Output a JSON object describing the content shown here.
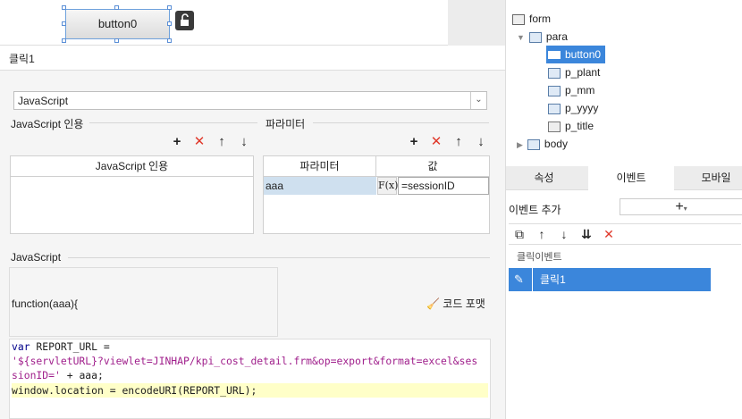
{
  "canvas": {
    "button_label": "button0"
  },
  "event_panel": {
    "title": "클릭1",
    "language_select": "JavaScript",
    "js_ref_label": "JavaScript 인용",
    "js_ref_header": "JavaScript 인용",
    "params_label": "파라미터",
    "params_header_name": "파라미터",
    "params_header_value": "값",
    "params_rows": [
      {
        "name": "aaa",
        "fx": "F(x)",
        "value": "=sessionID"
      }
    ],
    "js_label": "JavaScript",
    "function_sig": "function(aaa){",
    "format_button": "코드 포맷",
    "code": {
      "l1_kw": "var",
      "l1_rest": " REPORT_URL =",
      "l2": "'${servletURL}?viewlet=JINHAP/kpi_cost_detail.frm&op=export&format=excel&ses",
      "l3_str": "sionID='",
      "l3_rest": " + aaa;",
      "l4": "window.location = encodeURI(REPORT_URL);"
    }
  },
  "tree": {
    "root": "form",
    "para": "para",
    "children": [
      "button0",
      "p_plant",
      "p_mm",
      "p_yyyy",
      "p_title"
    ],
    "body": "body"
  },
  "tabs": {
    "properties": "속성",
    "events": "이벤트",
    "mobile": "모바일"
  },
  "events": {
    "add_label": "이벤트 추가",
    "list_header": "클릭이벤트",
    "items": [
      "클릭1"
    ]
  },
  "colors": {
    "selection": "#3b86db",
    "highlight": "#ffffc8",
    "delete": "#e0392b"
  }
}
